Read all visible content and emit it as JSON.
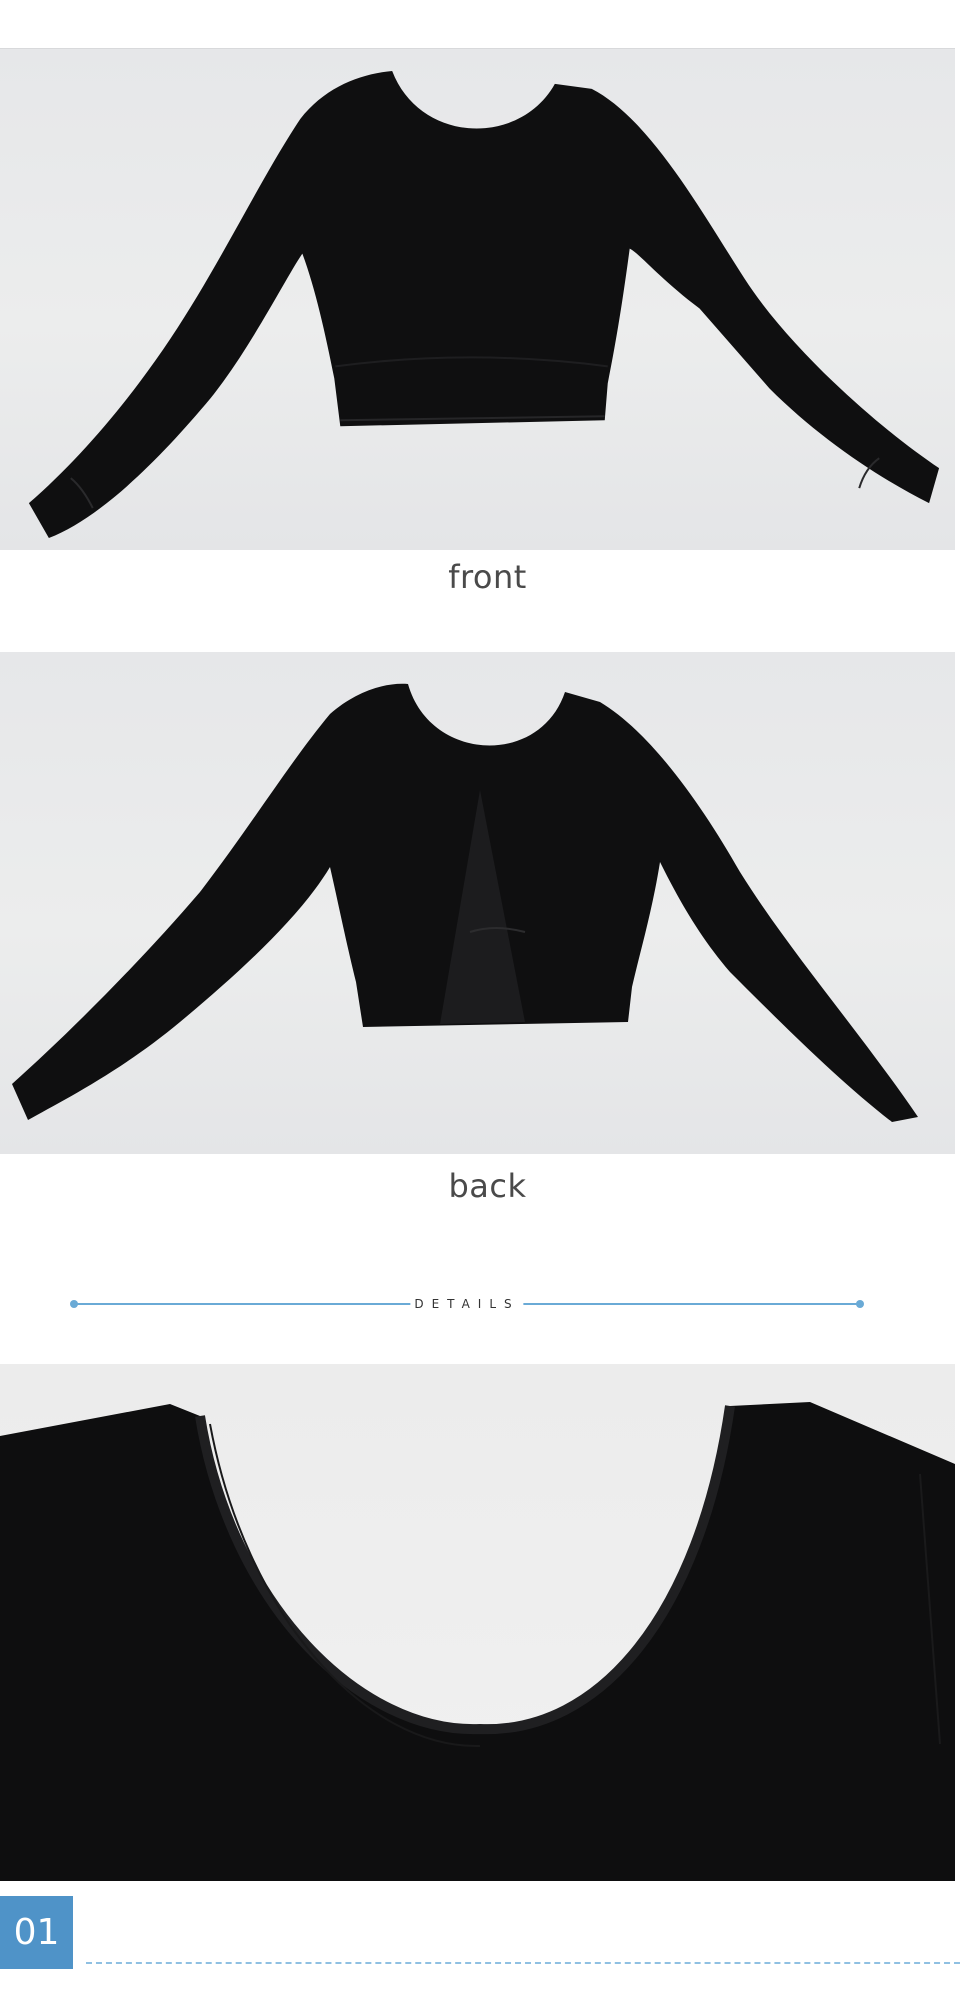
{
  "front_caption": "front",
  "back_caption": "back",
  "details_label": "DETAILS",
  "section_number": "01",
  "colors": {
    "accent_blue": "#4f93c8",
    "line_blue": "#6aaad6",
    "garment": "#111111",
    "backdrop": "#e8e9eb"
  },
  "icons": [
    "shirt-front-photo",
    "shirt-back-photo",
    "neckline-detail-photo"
  ]
}
